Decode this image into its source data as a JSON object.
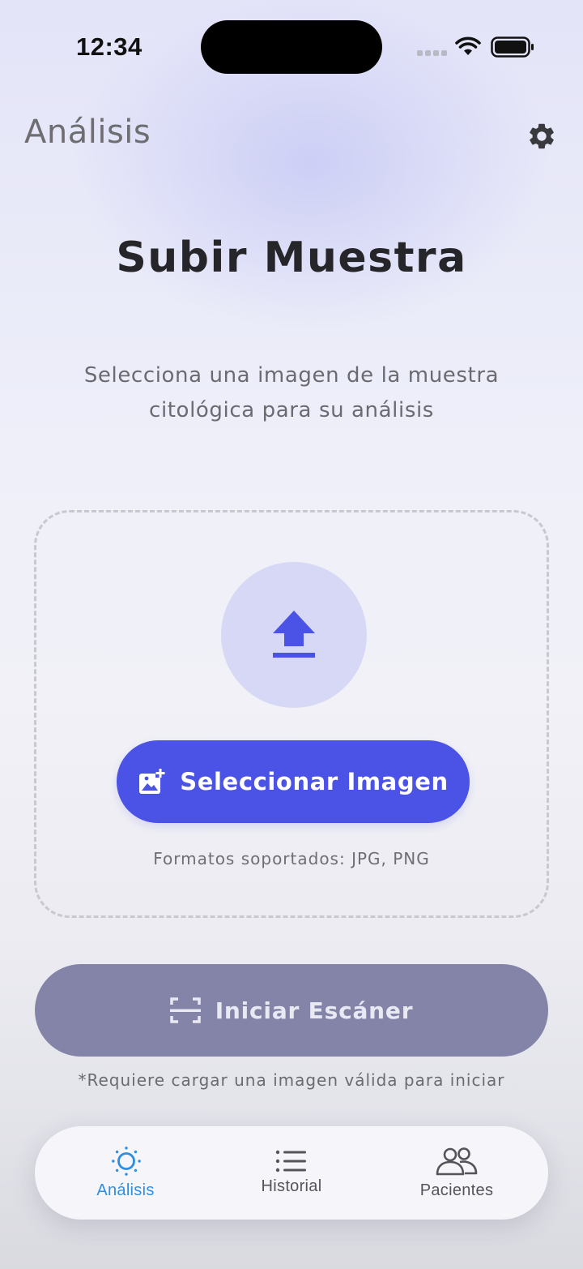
{
  "status_bar": {
    "time": "12:34"
  },
  "header": {
    "title": "Análisis",
    "settings_icon": "gear-icon"
  },
  "main": {
    "title": "Subir Muestra",
    "subtitle": "Selecciona una imagen de la muestra citológica para su análisis"
  },
  "upload": {
    "icon": "upload-icon",
    "button_label": "Seleccionar Imagen",
    "button_icon": "add-photo-icon",
    "formats": "Formatos soportados: JPG, PNG"
  },
  "scan": {
    "button_label": "Iniciar Escáner",
    "button_icon": "scan-frame-icon",
    "note": "*Requiere cargar una imagen válida para iniciar"
  },
  "tabs": [
    {
      "label": "Análisis",
      "icon": "sun-icon",
      "active": true
    },
    {
      "label": "Historial",
      "icon": "list-icon",
      "active": false
    },
    {
      "label": "Pacientes",
      "icon": "people-icon",
      "active": false
    }
  ],
  "colors": {
    "accent": "#4b52e6",
    "active_tab": "#2f8ee0",
    "disabled_button": "#8384a8",
    "upload_circle": "#d7d8f5"
  }
}
